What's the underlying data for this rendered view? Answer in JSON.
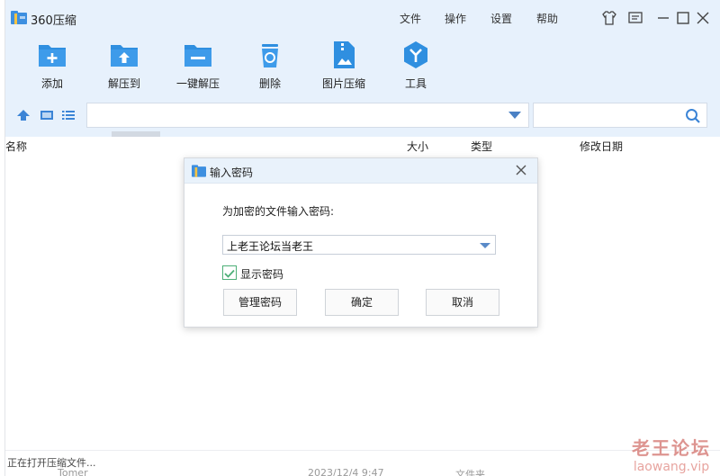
{
  "app": {
    "title": "360压缩"
  },
  "menu": [
    "文件",
    "操作",
    "设置",
    "帮助"
  ],
  "window_controls": [
    "shirt-icon",
    "feedback-icon",
    "minimize-icon",
    "maximize-icon",
    "close-icon"
  ],
  "toolbar": {
    "items": [
      {
        "label": "添加",
        "icon": "add-folder-icon"
      },
      {
        "label": "解压到",
        "icon": "extract-to-icon"
      },
      {
        "label": "一键解压",
        "icon": "one-click-extract-icon"
      },
      {
        "label": "删除",
        "icon": "delete-icon"
      },
      {
        "label": "图片压缩",
        "icon": "image-compress-icon"
      },
      {
        "label": "工具",
        "icon": "tools-icon"
      }
    ]
  },
  "nav": {
    "path_value": "",
    "search_placeholder": ""
  },
  "columns": [
    "名称",
    "大小",
    "类型",
    "修改日期"
  ],
  "status": {
    "text": "正在打开压缩文件...",
    "ghost_row": {
      "name": "Tomer",
      "date": "2023/12/4 9:47",
      "type": "文件夹"
    }
  },
  "watermark": {
    "main": "老王论坛",
    "sub": "laowang.vip"
  },
  "dialog": {
    "title": "输入密码",
    "prompt": "为加密的文件输入密码:",
    "password": "上老王论坛当老王",
    "show_password_label": "显示密码",
    "show_password_checked": true,
    "buttons": {
      "manage": "管理密码",
      "ok": "确定",
      "cancel": "取消"
    }
  },
  "colors": {
    "accent": "#2f8fe0",
    "toolbar_bg": "#e7f1fc",
    "check": "#4caf77"
  }
}
